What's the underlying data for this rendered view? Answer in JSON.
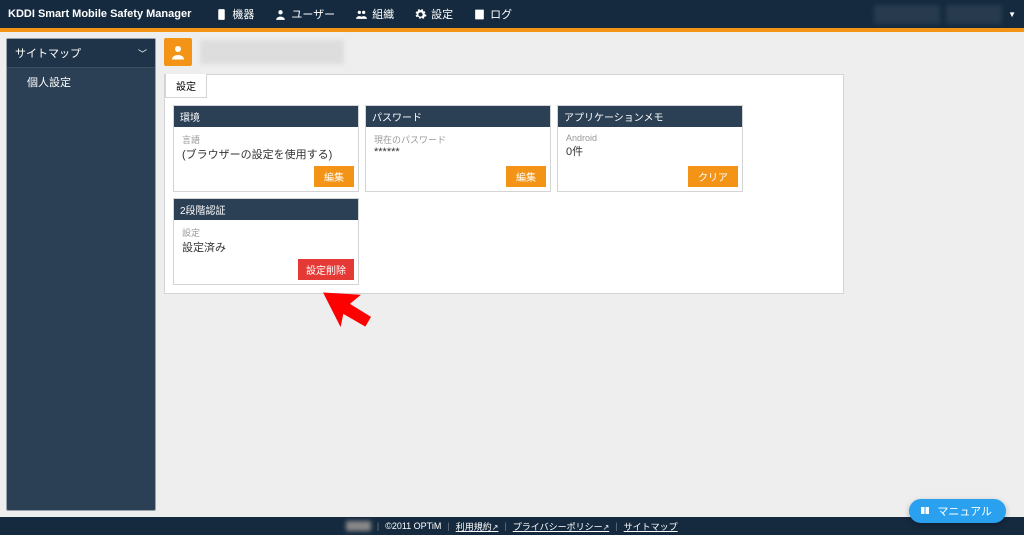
{
  "brand": "KDDI Smart Mobile Safety Manager",
  "nav": {
    "devices": "機器",
    "users": "ユーザー",
    "orgs": "組織",
    "settings": "設定",
    "logs": "ログ"
  },
  "user_org": "　　　　　",
  "user_name": "　　　　",
  "sidebar": {
    "header": "サイトマップ",
    "items": [
      "個人設定"
    ]
  },
  "main": {
    "user_label": "　　　　　　",
    "tab": "設定",
    "cards": {
      "env": {
        "title": "環境",
        "label": "言語",
        "value": "(ブラウザーの設定を使用する)",
        "button": "編集"
      },
      "pw": {
        "title": "パスワード",
        "label": "現在のパスワード",
        "value": "******",
        "button": "編集"
      },
      "memo": {
        "title": "アプリケーションメモ",
        "label": "Android",
        "value": "0件",
        "button": "クリア"
      },
      "mfa": {
        "title": "2段階認証",
        "label": "設定",
        "value": "設定済み",
        "button": "設定削除"
      }
    }
  },
  "footer": {
    "copyright": "©2011 OPTiM",
    "links": [
      "利用規約",
      "プライバシーポリシー",
      "サイトマップ"
    ]
  },
  "manual": "マニュアル"
}
